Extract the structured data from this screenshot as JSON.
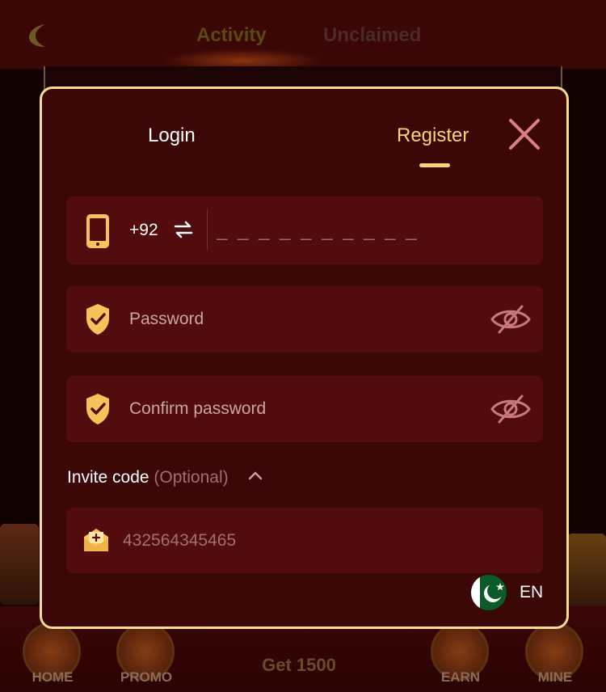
{
  "background": {
    "tabs": [
      "Activity",
      "Unclaimed"
    ],
    "nav": {
      "items": [
        "HOME",
        "PROMO",
        "EARN",
        "MINE"
      ],
      "center_label": "Get 1500"
    }
  },
  "modal": {
    "tabs": {
      "login": "Login",
      "register": "Register",
      "active": "Register"
    },
    "phone": {
      "country_code": "+92",
      "placeholder": "_ _ _ _ _ _ _ _ _ _"
    },
    "password": {
      "placeholder": "Password"
    },
    "confirm_password": {
      "placeholder": "Confirm password"
    },
    "invite": {
      "label": "Invite code",
      "optional": "(Optional)",
      "value": "432564345465"
    },
    "language": {
      "code": "EN"
    }
  },
  "colors": {
    "accent": "#f8d57a",
    "modal_bg": "#3b0707",
    "field_bg": "#520c0d",
    "border": "#f6dc8c"
  }
}
